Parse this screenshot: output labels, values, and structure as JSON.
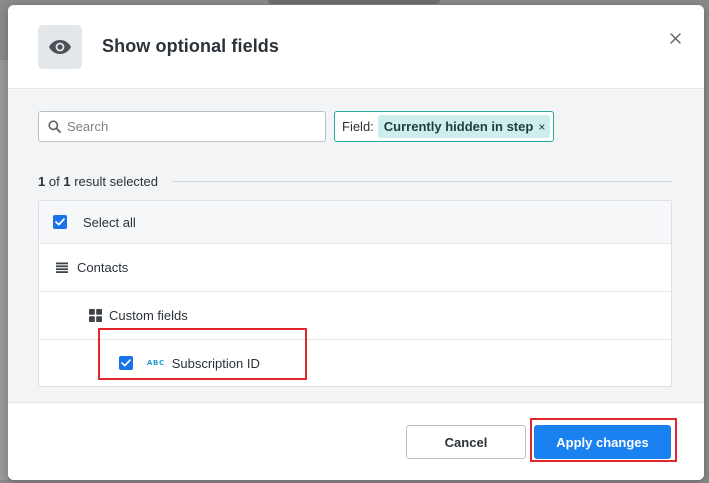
{
  "dialog": {
    "title": "Show optional fields",
    "header_icon": "eye-icon",
    "close_icon": "close-icon"
  },
  "search": {
    "placeholder": "Search",
    "value": "",
    "icon": "search-icon"
  },
  "filter": {
    "label": "Field:",
    "value": "Currently hidden in step",
    "remove_glyph": "×"
  },
  "summary": {
    "selected_count": "1",
    "of_text": "of",
    "total_count": "1",
    "suffix": "result selected"
  },
  "tree": {
    "select_all": {
      "label": "Select all",
      "checked": true
    },
    "groups": [
      {
        "label": "Contacts",
        "icon": "list-icon",
        "children": [
          {
            "label": "Custom fields",
            "icon": "grid-icon",
            "fields": [
              {
                "label": "Subscription ID",
                "type_badge": "ABC",
                "checked": true
              }
            ]
          }
        ]
      }
    ]
  },
  "footer": {
    "cancel_label": "Cancel",
    "apply_label": "Apply changes"
  },
  "colors": {
    "accent": "#1a82f0",
    "checkbox": "#1a73e8",
    "chip_border": "#2aa9a0",
    "chip_fill": "#cdeeed",
    "highlight": "#e3262b",
    "text_type_badge": "#1f9ec9"
  }
}
